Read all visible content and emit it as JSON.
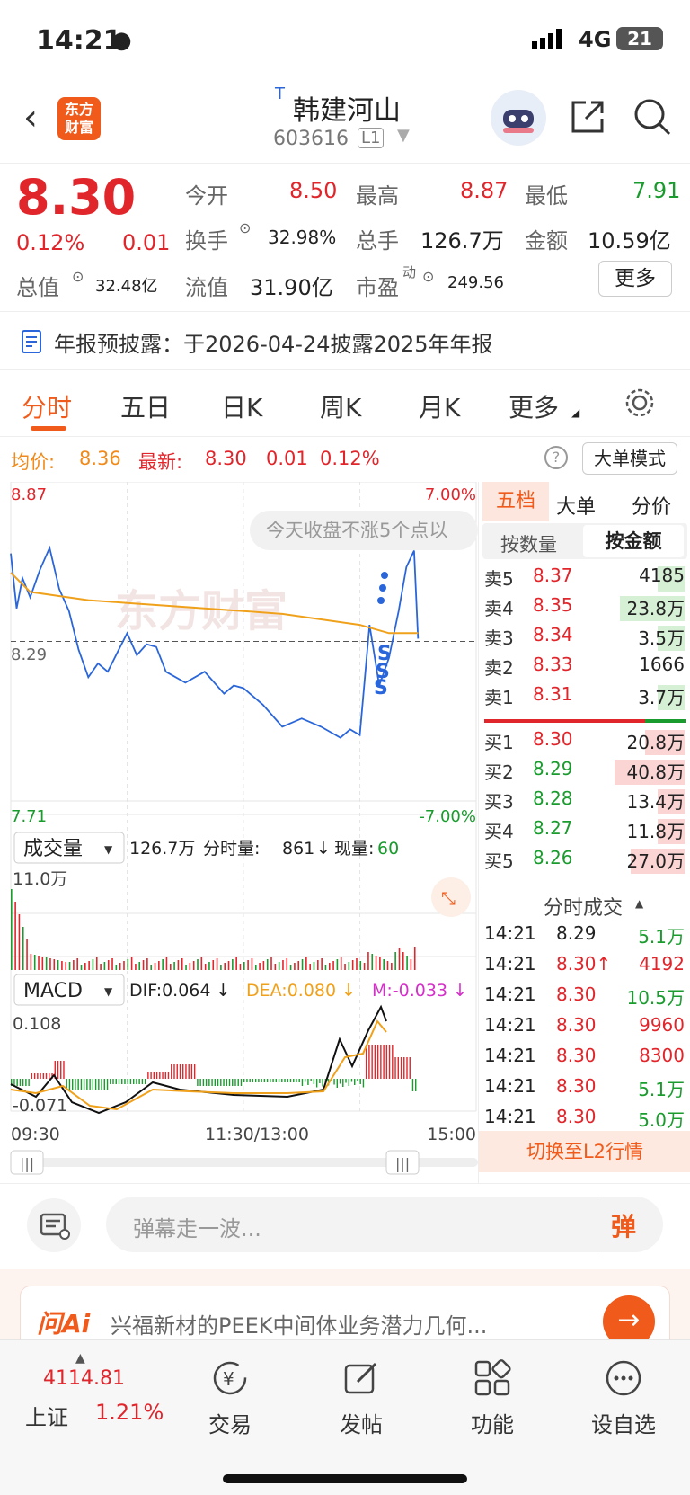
{
  "status": {
    "time": "14:21",
    "network": "4G",
    "battery": "21"
  },
  "header": {
    "logo_line1": "东方",
    "logo_line2": "财富",
    "tag": "T",
    "name": "韩建河山",
    "code": "603616",
    "level": "L1"
  },
  "quote": {
    "price": "8.30",
    "change_pct": "0.12%",
    "change": "0.01",
    "open_label": "今开",
    "open": "8.50",
    "high_label": "最高",
    "high": "8.87",
    "low_label": "最低",
    "low": "7.91",
    "turnover_label": "换手",
    "turnover": "32.98%",
    "volume_label": "总手",
    "volume": "126.7万",
    "amount_label": "金额",
    "amount": "10.59亿",
    "mcap_label": "总值",
    "mcap": "32.48亿",
    "float_label": "流值",
    "float": "31.90亿",
    "pe_label": "市盈",
    "pe_sup": "动",
    "pe": "249.56",
    "more_button": "更多"
  },
  "banner": {
    "text": "年报预披露：于2026-04-24披露2025年年报"
  },
  "tabs": [
    "分时",
    "五日",
    "日K",
    "周K",
    "月K",
    "更多"
  ],
  "chart_info": {
    "avg_label": "均价:",
    "avg": "8.36",
    "latest_label": "最新:",
    "latest": "8.30",
    "chg": "0.01",
    "pct": "0.12%",
    "mode_button": "大单模式",
    "help": "?"
  },
  "chart": {
    "top_price": "8.87",
    "mid_price": "8.29",
    "bottom_price": "7.71",
    "top_pct": "7.00%",
    "bottom_pct": "-7.00%",
    "overlay": "今天收盘不涨5个点以",
    "watermark": "东方财富",
    "vol_select": "成交量",
    "vol_total": "126.7万",
    "vol_tick_label": "分时量:",
    "vol_tick": "861",
    "vol_now_label": "现量:",
    "vol_now": "60",
    "vol_axis": "11.0万",
    "macd_select": "MACD",
    "dif": "DIF:0.064 ↓",
    "dea": "DEA:0.080 ↓",
    "m": "M:-0.033 ↓",
    "macd_top": "0.108",
    "macd_bottom": "-0.071",
    "time_start": "09:30",
    "time_mid": "11:30/13:00",
    "time_end": "15:00"
  },
  "chart_data": {
    "type": "line",
    "x_label": "time",
    "y_range": [
      7.71,
      8.87
    ],
    "series": [
      {
        "name": "price",
        "points": [
          [
            0,
            8.61
          ],
          [
            3,
            8.41
          ],
          [
            6,
            8.52
          ],
          [
            10,
            8.45
          ],
          [
            15,
            8.55
          ],
          [
            20,
            8.63
          ],
          [
            25,
            8.48
          ],
          [
            30,
            8.4
          ],
          [
            35,
            8.26
          ],
          [
            40,
            8.16
          ],
          [
            45,
            8.21
          ],
          [
            50,
            8.18
          ],
          [
            55,
            8.25
          ],
          [
            60,
            8.32
          ],
          [
            65,
            8.24
          ],
          [
            70,
            8.28
          ],
          [
            75,
            8.27
          ],
          [
            80,
            8.18
          ],
          [
            90,
            8.14
          ],
          [
            100,
            8.18
          ],
          [
            110,
            8.1
          ],
          [
            115,
            8.13
          ],
          [
            120,
            8.12
          ],
          [
            130,
            8.06
          ],
          [
            140,
            7.98
          ],
          [
            150,
            8.01
          ],
          [
            160,
            7.98
          ],
          [
            170,
            7.94
          ],
          [
            175,
            7.97
          ],
          [
            180,
            7.95
          ],
          [
            185,
            8.35
          ],
          [
            190,
            8.13
          ],
          [
            195,
            8.23
          ],
          [
            200,
            8.4
          ],
          [
            204,
            8.56
          ],
          [
            208,
            8.62
          ],
          [
            210,
            8.3
          ]
        ]
      },
      {
        "name": "avg",
        "points": [
          [
            0,
            8.54
          ],
          [
            10,
            8.47
          ],
          [
            20,
            8.46
          ],
          [
            40,
            8.44
          ],
          [
            60,
            8.43
          ],
          [
            80,
            8.42
          ],
          [
            100,
            8.41
          ],
          [
            120,
            8.4
          ],
          [
            140,
            8.39
          ],
          [
            160,
            8.37
          ],
          [
            180,
            8.35
          ],
          [
            195,
            8.32
          ],
          [
            210,
            8.32
          ]
        ]
      }
    ]
  },
  "orderbook": {
    "tabs": [
      "五档",
      "大单",
      "分价"
    ],
    "sub_tabs": [
      "按数量",
      "按金额"
    ],
    "asks": [
      {
        "label": "卖5",
        "price": "8.37",
        "qty": "4185"
      },
      {
        "label": "卖4",
        "price": "8.35",
        "qty": "23.8万"
      },
      {
        "label": "卖3",
        "price": "8.34",
        "qty": "3.5万"
      },
      {
        "label": "卖2",
        "price": "8.33",
        "qty": "1666"
      },
      {
        "label": "卖1",
        "price": "8.31",
        "qty": "3.7万"
      }
    ],
    "bids": [
      {
        "label": "买1",
        "price": "8.30",
        "qty": "20.8万"
      },
      {
        "label": "买2",
        "price": "8.29",
        "qty": "40.8万"
      },
      {
        "label": "买3",
        "price": "8.28",
        "qty": "13.4万"
      },
      {
        "label": "买4",
        "price": "8.27",
        "qty": "11.8万"
      },
      {
        "label": "买5",
        "price": "8.26",
        "qty": "27.0万"
      }
    ],
    "ticks_title": "分时成交",
    "ticks": [
      {
        "time": "14:21",
        "price": "8.29",
        "qty": "5.1万"
      },
      {
        "time": "14:21",
        "price": "8.30↑",
        "qty": "4192"
      },
      {
        "time": "14:21",
        "price": "8.30",
        "qty": "10.5万"
      },
      {
        "time": "14:21",
        "price": "8.30",
        "qty": "9960"
      },
      {
        "time": "14:21",
        "price": "8.30",
        "qty": "8300"
      },
      {
        "time": "14:21",
        "price": "8.30",
        "qty": "5.1万"
      },
      {
        "time": "14:21",
        "price": "8.30",
        "qty": "5.0万"
      }
    ],
    "l2_button": "切换至L2行情"
  },
  "danmu": {
    "placeholder": "弹幕走一波...",
    "send": "弹"
  },
  "ai": {
    "logo": "问Ai",
    "text": "兴福新材的PEEK中间体业务潜力几何..."
  },
  "bottom": {
    "index_value": "4114.81",
    "index_name": "上证",
    "index_pct": "1.21%",
    "items": [
      "交易",
      "发帖",
      "功能",
      "设自选"
    ]
  }
}
